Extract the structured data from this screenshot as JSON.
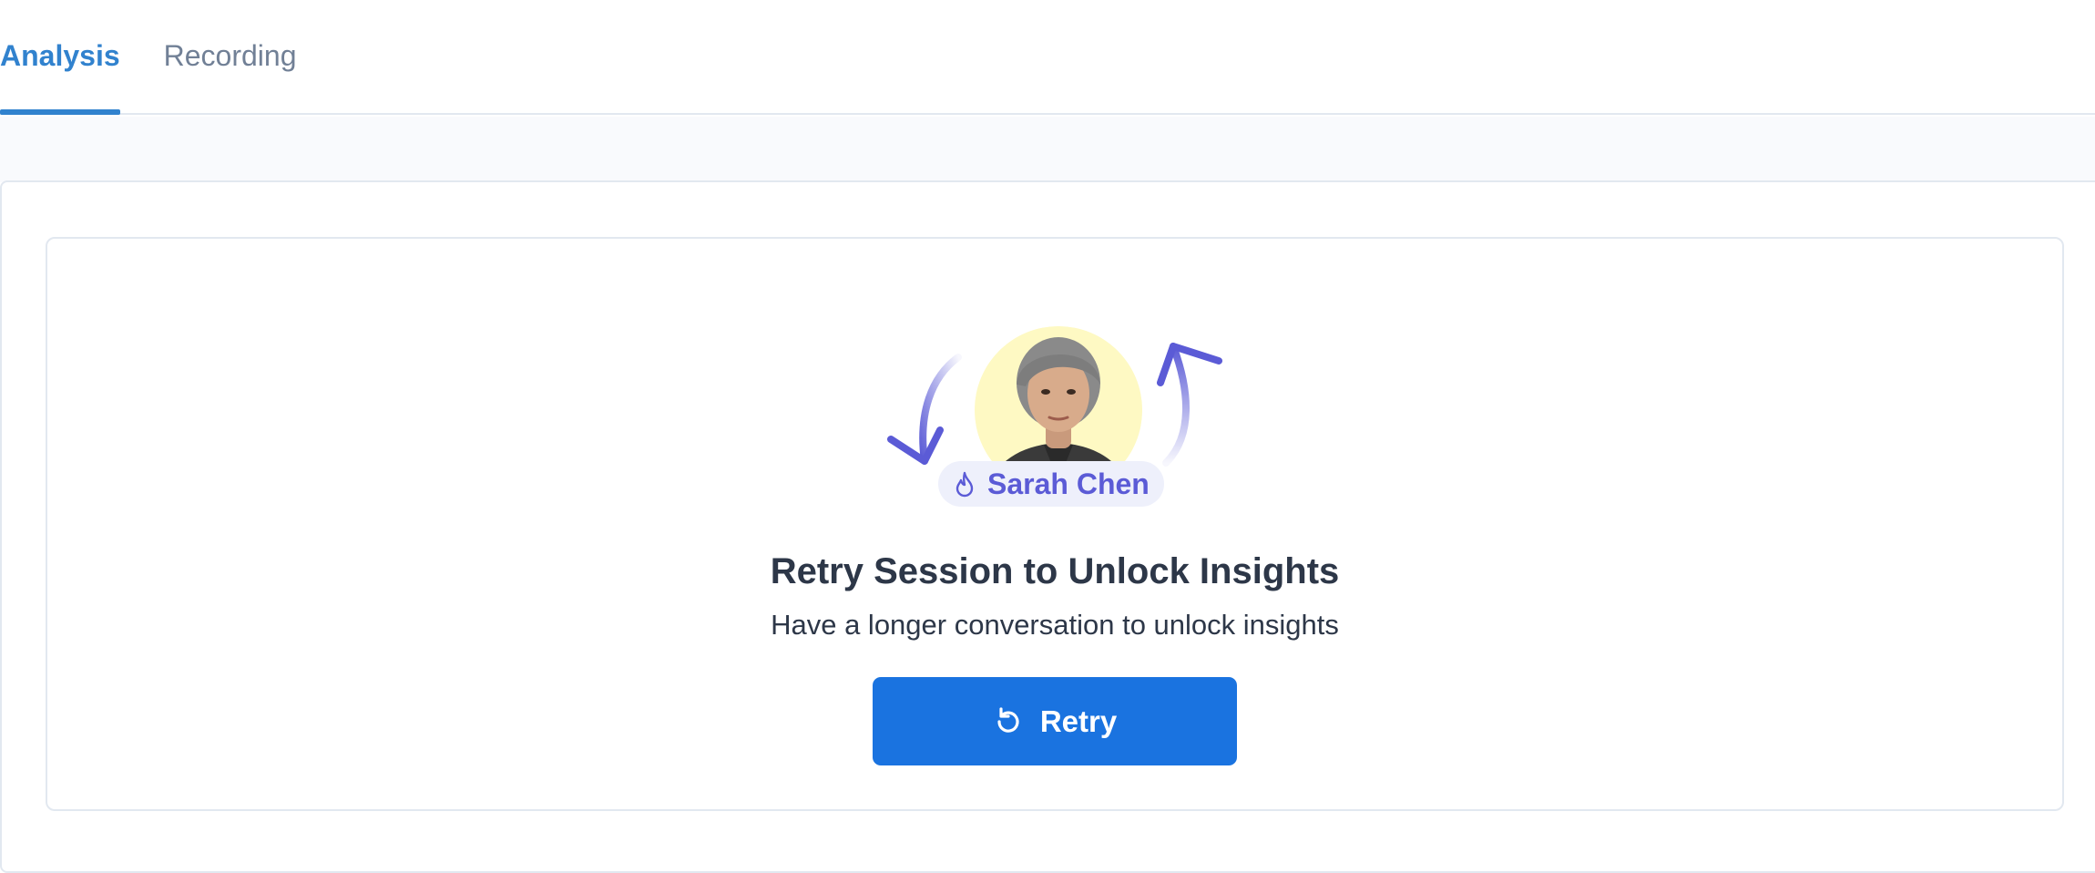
{
  "tabs": [
    {
      "label": "Analysis",
      "active": true
    },
    {
      "label": "Recording",
      "active": false
    }
  ],
  "persona": {
    "name": "Sarah Chen",
    "badge_icon": "flame-icon",
    "avatar_bg": "#fef9c3"
  },
  "empty_state": {
    "title": "Retry Session to Unlock Insights",
    "subtitle": "Have a longer conversation to unlock insights",
    "button_label": "Retry",
    "button_icon": "refresh-icon"
  },
  "colors": {
    "accent": "#3182ce",
    "button": "#1a73e0",
    "arrow": "#5b5bd6",
    "pill_bg": "#eef0fb"
  }
}
